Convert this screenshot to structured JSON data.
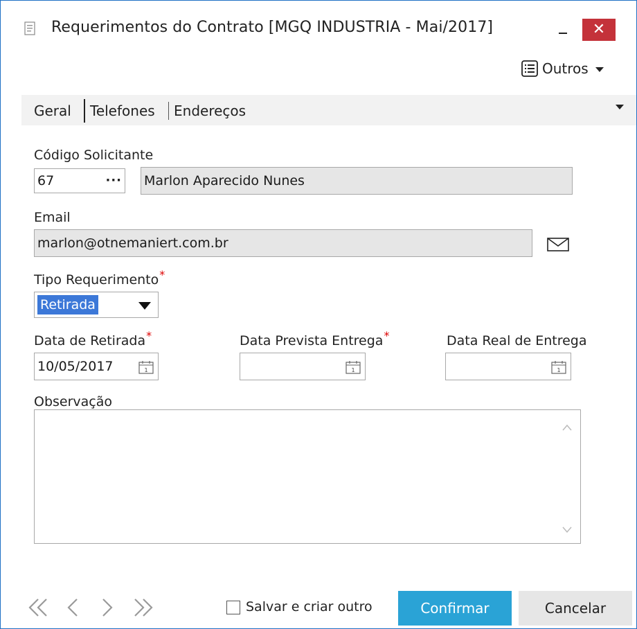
{
  "window": {
    "title": "Requerimentos do Contrato [MGQ INDUSTRIA - Mai/2017]",
    "minimize_label": "_",
    "close_label": "✕"
  },
  "toolbar": {
    "outros_label": "Outros"
  },
  "tabs": [
    {
      "label": "Geral"
    },
    {
      "label": "Telefones"
    },
    {
      "label": "Endereços"
    }
  ],
  "form": {
    "solicitante": {
      "label": "Código Solicitante",
      "code": "67",
      "lookup_label": "···",
      "name": "Marlon Aparecido Nunes"
    },
    "email": {
      "label": "Email",
      "value": "marlon@otnemaniert.com.br"
    },
    "tipo_requerimento": {
      "label": "Tipo Requerimento",
      "value": "Retirada"
    },
    "data_retirada": {
      "label": "Data de Retirada",
      "value": "10/05/2017"
    },
    "data_prevista": {
      "label": "Data Prevista Entrega",
      "value": ""
    },
    "data_real": {
      "label": "Data Real de Entrega",
      "value": ""
    },
    "observacao": {
      "label": "Observação",
      "value": ""
    },
    "required_mark": "*"
  },
  "footer": {
    "save_and_new_label": "Salvar e criar outro",
    "save_and_new_checked": false,
    "confirm_label": "Confirmar",
    "cancel_label": "Cancelar"
  },
  "colors": {
    "confirm_bg": "#2aa3d6",
    "close_bg": "#c4323a",
    "selection_bg": "#3c78d8",
    "window_border": "#1e6fc4"
  },
  "icons": [
    "document-icon",
    "list-icon",
    "mail-icon",
    "calendar-icon",
    "first-icon",
    "prev-icon",
    "next-icon",
    "last-icon"
  ]
}
